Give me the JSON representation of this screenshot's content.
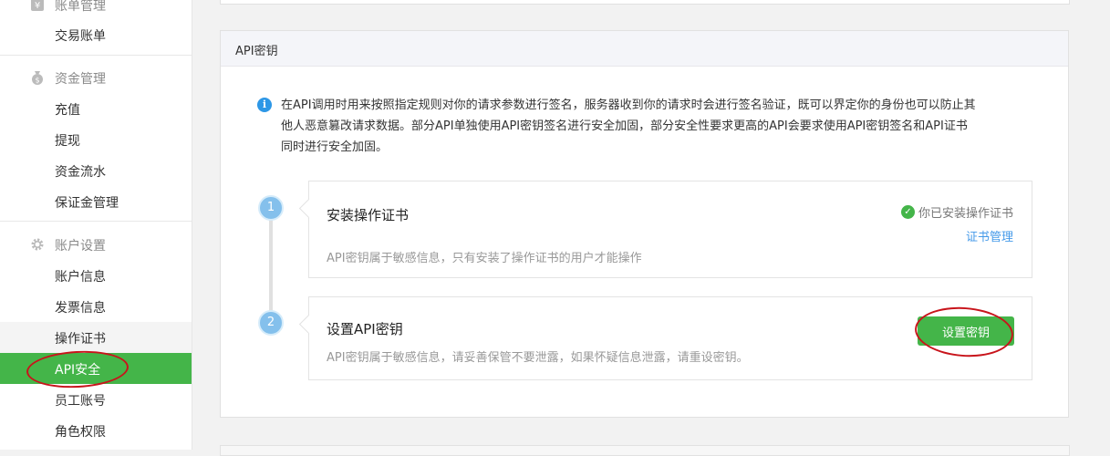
{
  "sidebar": {
    "groups": [
      {
        "label": "账单管理",
        "icon": "bill-icon",
        "items": [
          "交易账单"
        ]
      },
      {
        "label": "资金管理",
        "icon": "money-bag-icon",
        "items": [
          "充值",
          "提现",
          "资金流水",
          "保证金管理"
        ]
      },
      {
        "label": "账户设置",
        "icon": "gear-icon",
        "items": [
          "账户信息",
          "发票信息",
          "操作证书",
          "API安全",
          "员工账号",
          "角色权限"
        ]
      }
    ],
    "active_item": "API安全"
  },
  "panel": {
    "title": "API密钥",
    "info_line1": "在API调用时用来按照指定规则对你的请求参数进行签名，服务器收到你的请求时会进行签名验证，既可以界定你的身份也可以防止其",
    "info_line2": "他人恶意篡改请求数据。部分API单独使用API密钥签名进行安全加固，部分安全性要求更高的API会要求使用API密钥签名和API证书",
    "info_line3": "同时进行安全加固。"
  },
  "steps": [
    {
      "number": "1",
      "title": "安装操作证书",
      "desc": "API密钥属于敏感信息，只有安装了操作证书的用户才能操作",
      "status": "你已安装操作证书",
      "link": "证书管理"
    },
    {
      "number": "2",
      "title": "设置API密钥",
      "desc": "API密钥属于敏感信息，请妥善保管不要泄露，如果怀疑信息泄露，请重设密钥。",
      "button": "设置密钥"
    }
  ],
  "colors": {
    "accent": "#44b549",
    "link": "#459ae9",
    "annotation": "#c8141b"
  }
}
